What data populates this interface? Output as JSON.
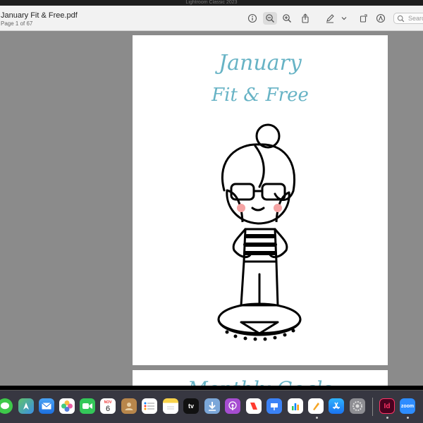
{
  "menubar": {
    "title": "Lightroom Classic 2023"
  },
  "window": {
    "title": "January Fit & Free.pdf",
    "subtitle": "Page 1 of 67"
  },
  "toolbar": {
    "search_placeholder": "Search"
  },
  "pages": [
    {
      "heading_line1": "January",
      "heading_line2": "Fit & Free"
    },
    {
      "heading": "Monthly Goals"
    }
  ],
  "dock": {
    "calendar_month": "NOV",
    "calendar_day": "6",
    "apps": [
      "Messages",
      "Maps",
      "Mail",
      "Photos",
      "FaceTime",
      "Calendar",
      "Contacts",
      "Reminders",
      "Notes",
      "Apple TV",
      "Downloads",
      "Podcasts",
      "News",
      "Keynote",
      "Numbers",
      "Pages",
      "App Store",
      "System Settings",
      "InDesign",
      "Zoom"
    ],
    "indesign_label": "Id",
    "zoom_label": "zoom",
    "tv_label": "tv"
  },
  "colors": {
    "heading": "#67b3c5",
    "canvas": "#8b8b8b"
  }
}
